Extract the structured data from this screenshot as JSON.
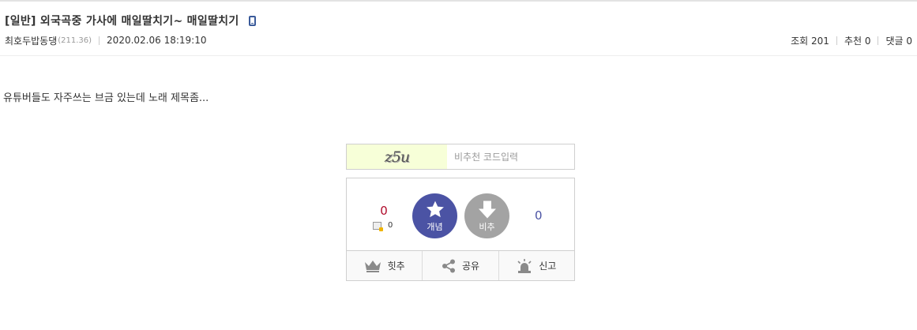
{
  "post": {
    "title": "[일반] 외국곡중 가사에 매일딸치기~ 매일딸치기",
    "author": "최호두밥동댕",
    "ip": "(211.36)",
    "date": "2020.02.06 18:19:10",
    "views": "조회 201",
    "recommends": "추천 0",
    "comments": "댓글 0",
    "body": "유튜버들도 자주쓰는 브금 있는데 노래 제목좀..."
  },
  "captcha": {
    "image_text": "z5u",
    "placeholder": "비추천 코드입력"
  },
  "vote": {
    "up_count": "0",
    "fix_count": "0",
    "up_label": "개념",
    "down_label": "비추",
    "down_count": "0",
    "up_color": "#4b53a4",
    "down_color": "#a3a3a3"
  },
  "actions": {
    "hit": "힛추",
    "share": "공유",
    "report": "신고"
  }
}
